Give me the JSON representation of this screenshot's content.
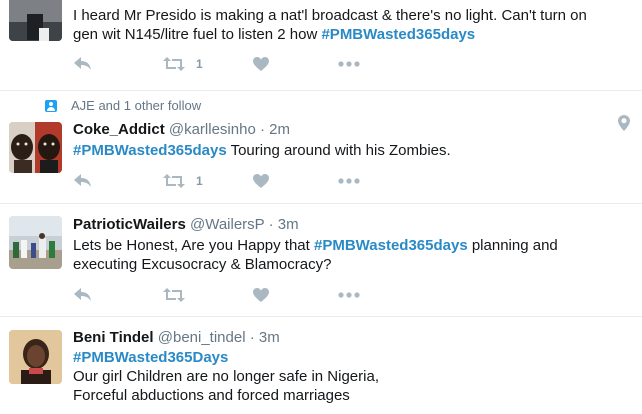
{
  "tweets": [
    {
      "text_line1": "I heard Mr Presido is making a nat'l  broadcast & there's no light. Can't turn on",
      "text_line2_prefix": "gen wit N145/litre fuel to listen 2 how ",
      "hashtag": "#PMBWasted365days",
      "retweet_count": "1"
    },
    {
      "context": "AJE and 1 other follow",
      "name": "Coke_Addict",
      "handle": "@karllesinho",
      "separator": "·",
      "time": "2m",
      "hashtag": "#PMBWasted365days",
      "text_suffix": " Touring around with his Zombies.",
      "retweet_count": "1"
    },
    {
      "name": "PatrioticWailers",
      "handle": "@WailersP",
      "separator": "·",
      "time": "3m",
      "text_prefix": "Lets be Honest, Are you Happy that ",
      "hashtag": "#PMBWasted365days",
      "text_suffix": " planning and",
      "text_line2": "executing Excusocracy & Blamocracy?"
    },
    {
      "name": "Beni Tindel",
      "handle": "@beni_tindel",
      "separator": "·",
      "time": "3m",
      "hashtag": "#PMBWasted365Days",
      "text_line2": "Our girl Children are no longer safe in Nigeria,",
      "text_line3": "Forceful abductions and forced marriages"
    }
  ],
  "icons": {
    "reply": "reply-icon",
    "retweet": "retweet-icon",
    "like": "heart-icon",
    "more": "more-icon",
    "location": "location-pin-icon",
    "follow_context": "person-icon"
  },
  "colors": {
    "hashtag": "#2a8ac6",
    "muted_text": "#657786",
    "action_icon": "#aab8c2",
    "divider": "#e6ecf0"
  }
}
